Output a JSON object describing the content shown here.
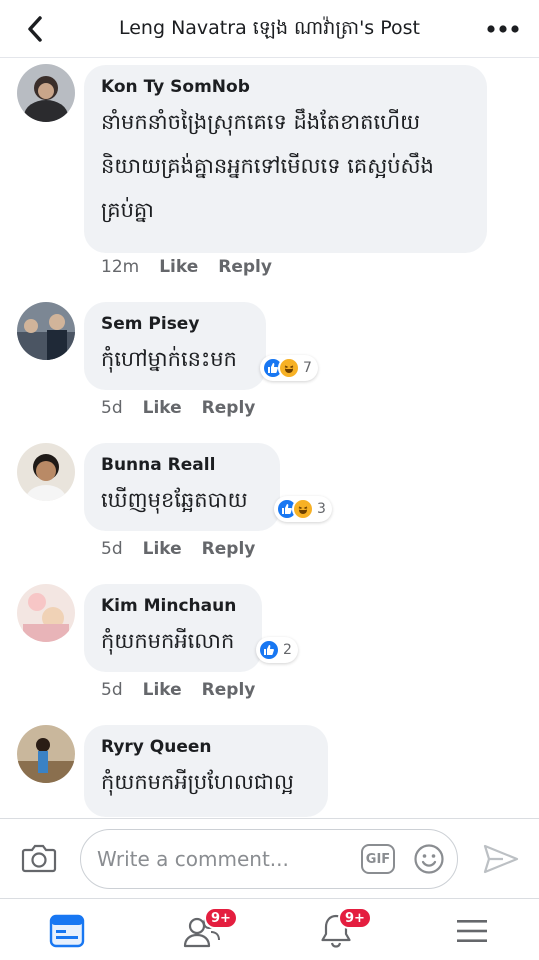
{
  "header": {
    "title": "Leng Navatra   ឡេង ណាវ៉ាត្រា's Post",
    "back_icon": "chevron-left-icon",
    "more_icon": "more-dots-icon"
  },
  "comments": [
    {
      "author": "Kon Ty SomNob",
      "text_lines": [
        "នាំមកនាំចង្រៃស្រុកគេទេ ដឹងតែខាតហើយ",
        "និយាយគ្រង់គ្នានអ្នកទៅមើលទេ គេស្អប់សឹង",
        "គ្រប់គ្នា"
      ],
      "time": "12m",
      "like_label": "Like",
      "reply_label": "Reply"
    },
    {
      "author": "Sem Pisey",
      "text_lines": [
        "កុំហៅម្នាក់នេះមក"
      ],
      "time": "5d",
      "like_label": "Like",
      "reply_label": "Reply",
      "reaction_count": "7"
    },
    {
      "author": "Bunna Reall",
      "text_lines": [
        "ឃើញមុខឆ្អែតបាយ"
      ],
      "time": "5d",
      "like_label": "Like",
      "reply_label": "Reply",
      "reaction_count": "3"
    },
    {
      "author": "Kim Minchaun",
      "text_lines": [
        "កុំយកមកអីលោក"
      ],
      "time": "5d",
      "like_label": "Like",
      "reply_label": "Reply",
      "reaction_count": "2"
    },
    {
      "author": "Ryry Queen",
      "text_lines": [
        "កុំយកមកអីប្រហែលជាល្អ"
      ]
    }
  ],
  "composer": {
    "placeholder": "Write a comment...",
    "gif_label": "GIF"
  },
  "tabs": {
    "friends_badge": "9+",
    "notifications_badge": "9+"
  },
  "colors": {
    "like_blue": "#1877f2",
    "haha_yellow": "#f7b125",
    "badge_red": "#e41e3f"
  }
}
